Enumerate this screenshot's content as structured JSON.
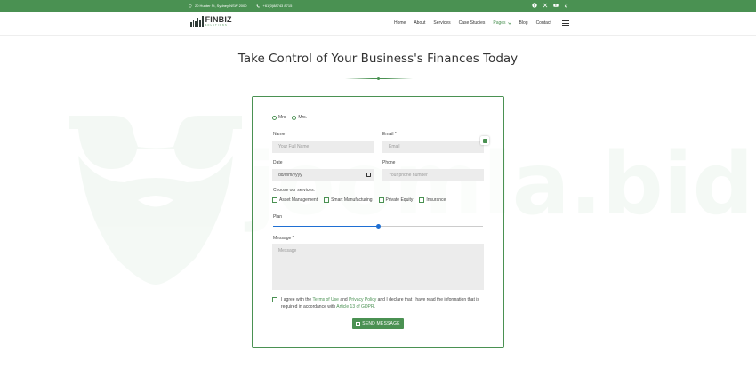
{
  "topbar": {
    "address": "20 Hunter St, Sydney NSW 2000",
    "phone": "+61(0)88743 8715",
    "social_icons": [
      "facebook-icon",
      "x-icon",
      "youtube-icon",
      "tiktok-icon"
    ]
  },
  "header": {
    "logo_brand": "FINBIZ",
    "logo_sub": "SOLUTIONS",
    "nav": [
      "Home",
      "About",
      "Services",
      "Case Studies",
      "Pages",
      "Blog",
      "Contact"
    ],
    "active_nav": "Pages"
  },
  "page": {
    "title": "Take Control of Your Business's Finances Today"
  },
  "watermark": {
    "text": "joomla.bid"
  },
  "form": {
    "salutations": [
      "Mrs",
      "Mrs."
    ],
    "name_label": "Name",
    "name_placeholder": "Your Full Name",
    "email_label": "Email *",
    "email_placeholder": "Email",
    "date_label": "Date",
    "date_placeholder": "dd/mm/yyyy",
    "phone_label": "Phone",
    "phone_placeholder": "Your phone number",
    "services_label": "Choose our services:",
    "services": [
      "Asset Management",
      "Smart Manufacturing",
      "Private Equity",
      "Insurance"
    ],
    "plan_label": "Plan",
    "plan_value_fraction": 0.5,
    "message_label": "Message *",
    "message_placeholder": "Message",
    "agree_prefix": "I agree with the ",
    "terms_link": "Terms of Use",
    "agree_and": " and ",
    "privacy_link": "Privacy Policy",
    "agree_mid": " and I declare that I have read the information that is required in accordance with ",
    "gdpr_link": "Article 13 of GDPR",
    "agree_end": ".",
    "submit_label": "SEND MESSAGE"
  },
  "colors": {
    "brand_green": "#4a9152",
    "slider_blue": "#1f6fd3"
  }
}
